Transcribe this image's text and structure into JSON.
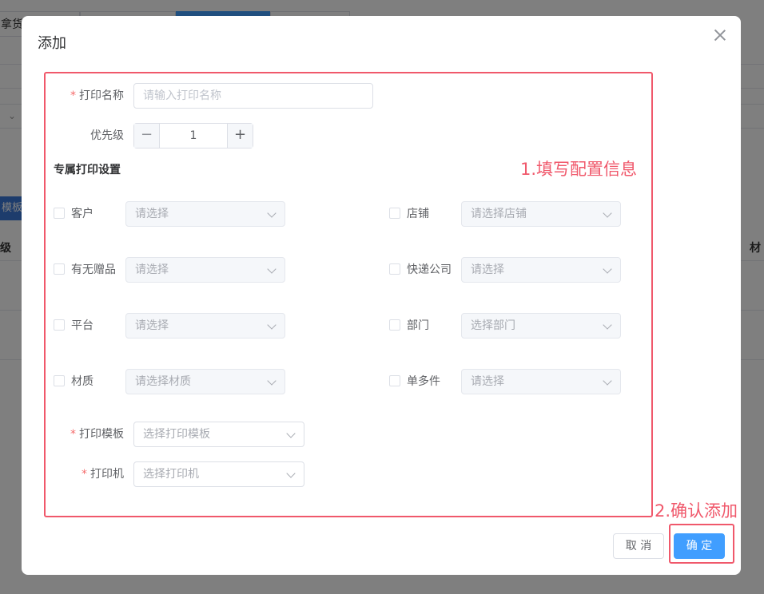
{
  "background": {
    "tabs": [
      "拿货",
      "",
      ""
    ],
    "button_label": "模板",
    "col_left": "级",
    "col_right": "材"
  },
  "dialog": {
    "title": "添加",
    "print_name_label": "打印名称",
    "print_name_placeholder": "请输入打印名称",
    "priority_label": "优先级",
    "priority_value": "1",
    "priority_minus": "−",
    "priority_plus": "+",
    "section_title": "专属打印设置",
    "filters": [
      {
        "label": "客户",
        "placeholder": "请选择"
      },
      {
        "label": "店铺",
        "placeholder": "请选择店铺"
      },
      {
        "label": "有无赠品",
        "placeholder": "请选择"
      },
      {
        "label": "快递公司",
        "placeholder": "请选择"
      },
      {
        "label": "平台",
        "placeholder": "请选择"
      },
      {
        "label": "部门",
        "placeholder": "选择部门"
      },
      {
        "label": "材质",
        "placeholder": "请选择材质"
      },
      {
        "label": "单多件",
        "placeholder": "请选择"
      }
    ],
    "template_label": "打印模板",
    "template_placeholder": "选择打印模板",
    "printer_label": "打印机",
    "printer_placeholder": "选择打印机",
    "cancel_label": "取 消",
    "confirm_label": "确 定"
  },
  "annotations": {
    "step1": "1.填写配置信息",
    "step2": "2.确认添加",
    "color": "#f0586b"
  },
  "colors": {
    "primary": "#409eff",
    "required": "#f56c6c"
  }
}
